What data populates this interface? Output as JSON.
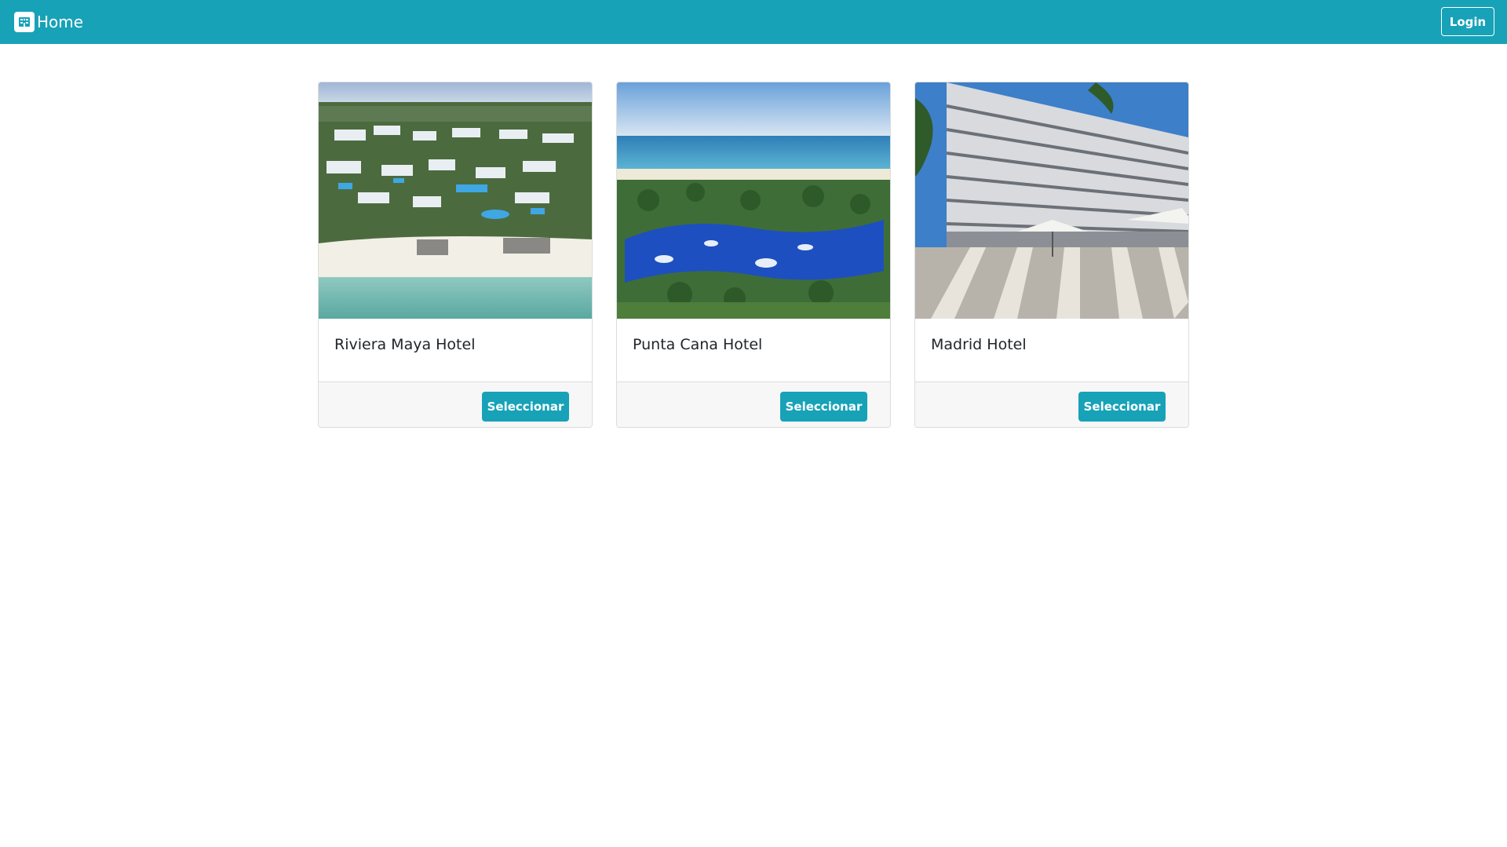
{
  "navbar": {
    "brand_label": "Home",
    "brand_icon": "hotel-icon",
    "login_label": "Login",
    "background_color": "#17a2b8"
  },
  "hotels": [
    {
      "name": "Riviera Maya Hotel",
      "button_label": "Seleccionar"
    },
    {
      "name": "Punta Cana Hotel",
      "button_label": "Seleccionar"
    },
    {
      "name": "Madrid Hotel",
      "button_label": "Seleccionar"
    }
  ],
  "colors": {
    "accent": "#17a2b8",
    "card_footer": "#f7f7f7",
    "card_border": "#dcdcdc",
    "title_text": "#212529"
  }
}
